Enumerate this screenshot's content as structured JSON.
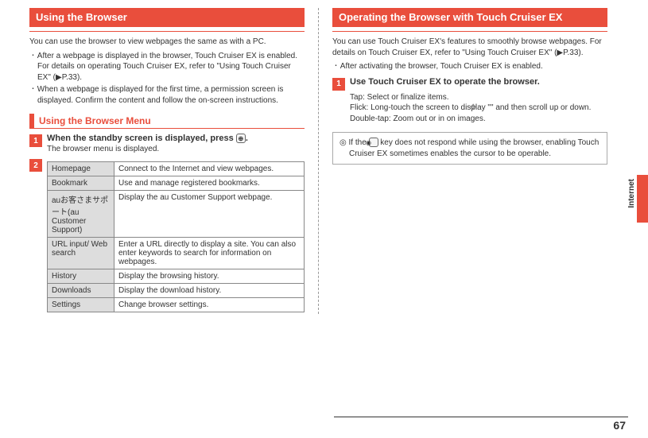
{
  "left": {
    "header1": "Using the Browser",
    "intro": "You can use the browser to view webpages the same as with a PC.",
    "bullets": [
      "After a webpage is displayed in the browser, Touch Cruiser EX is enabled. For details on operating Touch Cruiser EX, refer to \"Using Touch Cruiser EX\" (▶P.33).",
      "When a webpage is displayed for the first time, a permission screen is displayed. Confirm the content and follow the on-screen instructions."
    ],
    "subheader": "Using the Browser Menu",
    "step1_bold_pre": "When the standby screen is displayed, press ",
    "step1_bold_post": ".",
    "step1_sub": "The browser menu is displayed.",
    "menu": [
      {
        "label": "Homepage",
        "desc": "Connect to the Internet and view webpages."
      },
      {
        "label": "Bookmark",
        "desc": "Use and manage registered bookmarks."
      },
      {
        "label": "auお客さまサポート(au Customer Support)",
        "desc": "Display the au Customer Support webpage."
      },
      {
        "label": "URL input/ Web search",
        "desc": "Enter a URL directly to display a site. You can also enter keywords to search for information on webpages."
      },
      {
        "label": "History",
        "desc": "Display the browsing history."
      },
      {
        "label": "Downloads",
        "desc": "Display the download history."
      },
      {
        "label": "Settings",
        "desc": "Change browser settings."
      }
    ]
  },
  "right": {
    "header": "Operating the Browser with Touch Cruiser EX",
    "intro": "You can use Touch Cruiser EX's features to smoothly browse webpages. For details on Touch Cruiser EX, refer to \"Using Touch Cruiser EX\" (▶P.33).",
    "bullet": "After activating the browser, Touch Cruiser EX is enabled.",
    "step1_bold": "Use Touch Cruiser EX to operate the browser.",
    "actions": {
      "tap": "Tap: Select or finalize items.",
      "flick_pre": "Flick: Long-touch the screen to display \"",
      "flick_post": "\" and then scroll up or down.",
      "dtap": "Double-tap: Zoom out or in on images."
    },
    "note_pre": "If the ",
    "note_post": " key does not respond while using the browser, enabling Touch Cruiser EX sometimes enables the cursor to be operable."
  },
  "side_label": "Internet",
  "page_num": "67",
  "step_labels": {
    "one": "1",
    "two": "2"
  }
}
